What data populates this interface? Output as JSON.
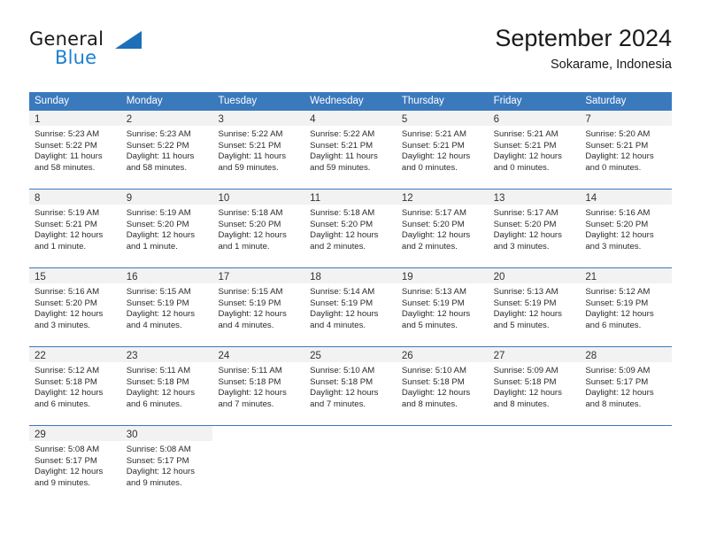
{
  "brand": {
    "name_part1": "General",
    "name_part2": "Blue",
    "triangle_color": "#1d6fb8",
    "blue_color": "#1c7fd1"
  },
  "header": {
    "title": "September 2024",
    "subtitle": "Sokarame, Indonesia"
  },
  "theme": {
    "header_bg": "#3b79bd",
    "row_divider": "#3b79bd",
    "daynum_bg": "#f2f2f2"
  },
  "weekdays": [
    "Sunday",
    "Monday",
    "Tuesday",
    "Wednesday",
    "Thursday",
    "Friday",
    "Saturday"
  ],
  "weeks": [
    [
      {
        "day": "1",
        "sunrise": "Sunrise: 5:23 AM",
        "sunset": "Sunset: 5:22 PM",
        "daylight1": "Daylight: 11 hours",
        "daylight2": "and 58 minutes."
      },
      {
        "day": "2",
        "sunrise": "Sunrise: 5:23 AM",
        "sunset": "Sunset: 5:22 PM",
        "daylight1": "Daylight: 11 hours",
        "daylight2": "and 58 minutes."
      },
      {
        "day": "3",
        "sunrise": "Sunrise: 5:22 AM",
        "sunset": "Sunset: 5:21 PM",
        "daylight1": "Daylight: 11 hours",
        "daylight2": "and 59 minutes."
      },
      {
        "day": "4",
        "sunrise": "Sunrise: 5:22 AM",
        "sunset": "Sunset: 5:21 PM",
        "daylight1": "Daylight: 11 hours",
        "daylight2": "and 59 minutes."
      },
      {
        "day": "5",
        "sunrise": "Sunrise: 5:21 AM",
        "sunset": "Sunset: 5:21 PM",
        "daylight1": "Daylight: 12 hours",
        "daylight2": "and 0 minutes."
      },
      {
        "day": "6",
        "sunrise": "Sunrise: 5:21 AM",
        "sunset": "Sunset: 5:21 PM",
        "daylight1": "Daylight: 12 hours",
        "daylight2": "and 0 minutes."
      },
      {
        "day": "7",
        "sunrise": "Sunrise: 5:20 AM",
        "sunset": "Sunset: 5:21 PM",
        "daylight1": "Daylight: 12 hours",
        "daylight2": "and 0 minutes."
      }
    ],
    [
      {
        "day": "8",
        "sunrise": "Sunrise: 5:19 AM",
        "sunset": "Sunset: 5:21 PM",
        "daylight1": "Daylight: 12 hours",
        "daylight2": "and 1 minute."
      },
      {
        "day": "9",
        "sunrise": "Sunrise: 5:19 AM",
        "sunset": "Sunset: 5:20 PM",
        "daylight1": "Daylight: 12 hours",
        "daylight2": "and 1 minute."
      },
      {
        "day": "10",
        "sunrise": "Sunrise: 5:18 AM",
        "sunset": "Sunset: 5:20 PM",
        "daylight1": "Daylight: 12 hours",
        "daylight2": "and 1 minute."
      },
      {
        "day": "11",
        "sunrise": "Sunrise: 5:18 AM",
        "sunset": "Sunset: 5:20 PM",
        "daylight1": "Daylight: 12 hours",
        "daylight2": "and 2 minutes."
      },
      {
        "day": "12",
        "sunrise": "Sunrise: 5:17 AM",
        "sunset": "Sunset: 5:20 PM",
        "daylight1": "Daylight: 12 hours",
        "daylight2": "and 2 minutes."
      },
      {
        "day": "13",
        "sunrise": "Sunrise: 5:17 AM",
        "sunset": "Sunset: 5:20 PM",
        "daylight1": "Daylight: 12 hours",
        "daylight2": "and 3 minutes."
      },
      {
        "day": "14",
        "sunrise": "Sunrise: 5:16 AM",
        "sunset": "Sunset: 5:20 PM",
        "daylight1": "Daylight: 12 hours",
        "daylight2": "and 3 minutes."
      }
    ],
    [
      {
        "day": "15",
        "sunrise": "Sunrise: 5:16 AM",
        "sunset": "Sunset: 5:20 PM",
        "daylight1": "Daylight: 12 hours",
        "daylight2": "and 3 minutes."
      },
      {
        "day": "16",
        "sunrise": "Sunrise: 5:15 AM",
        "sunset": "Sunset: 5:19 PM",
        "daylight1": "Daylight: 12 hours",
        "daylight2": "and 4 minutes."
      },
      {
        "day": "17",
        "sunrise": "Sunrise: 5:15 AM",
        "sunset": "Sunset: 5:19 PM",
        "daylight1": "Daylight: 12 hours",
        "daylight2": "and 4 minutes."
      },
      {
        "day": "18",
        "sunrise": "Sunrise: 5:14 AM",
        "sunset": "Sunset: 5:19 PM",
        "daylight1": "Daylight: 12 hours",
        "daylight2": "and 4 minutes."
      },
      {
        "day": "19",
        "sunrise": "Sunrise: 5:13 AM",
        "sunset": "Sunset: 5:19 PM",
        "daylight1": "Daylight: 12 hours",
        "daylight2": "and 5 minutes."
      },
      {
        "day": "20",
        "sunrise": "Sunrise: 5:13 AM",
        "sunset": "Sunset: 5:19 PM",
        "daylight1": "Daylight: 12 hours",
        "daylight2": "and 5 minutes."
      },
      {
        "day": "21",
        "sunrise": "Sunrise: 5:12 AM",
        "sunset": "Sunset: 5:19 PM",
        "daylight1": "Daylight: 12 hours",
        "daylight2": "and 6 minutes."
      }
    ],
    [
      {
        "day": "22",
        "sunrise": "Sunrise: 5:12 AM",
        "sunset": "Sunset: 5:18 PM",
        "daylight1": "Daylight: 12 hours",
        "daylight2": "and 6 minutes."
      },
      {
        "day": "23",
        "sunrise": "Sunrise: 5:11 AM",
        "sunset": "Sunset: 5:18 PM",
        "daylight1": "Daylight: 12 hours",
        "daylight2": "and 6 minutes."
      },
      {
        "day": "24",
        "sunrise": "Sunrise: 5:11 AM",
        "sunset": "Sunset: 5:18 PM",
        "daylight1": "Daylight: 12 hours",
        "daylight2": "and 7 minutes."
      },
      {
        "day": "25",
        "sunrise": "Sunrise: 5:10 AM",
        "sunset": "Sunset: 5:18 PM",
        "daylight1": "Daylight: 12 hours",
        "daylight2": "and 7 minutes."
      },
      {
        "day": "26",
        "sunrise": "Sunrise: 5:10 AM",
        "sunset": "Sunset: 5:18 PM",
        "daylight1": "Daylight: 12 hours",
        "daylight2": "and 8 minutes."
      },
      {
        "day": "27",
        "sunrise": "Sunrise: 5:09 AM",
        "sunset": "Sunset: 5:18 PM",
        "daylight1": "Daylight: 12 hours",
        "daylight2": "and 8 minutes."
      },
      {
        "day": "28",
        "sunrise": "Sunrise: 5:09 AM",
        "sunset": "Sunset: 5:17 PM",
        "daylight1": "Daylight: 12 hours",
        "daylight2": "and 8 minutes."
      }
    ],
    [
      {
        "day": "29",
        "sunrise": "Sunrise: 5:08 AM",
        "sunset": "Sunset: 5:17 PM",
        "daylight1": "Daylight: 12 hours",
        "daylight2": "and 9 minutes."
      },
      {
        "day": "30",
        "sunrise": "Sunrise: 5:08 AM",
        "sunset": "Sunset: 5:17 PM",
        "daylight1": "Daylight: 12 hours",
        "daylight2": "and 9 minutes."
      },
      {
        "day": "",
        "sunrise": "",
        "sunset": "",
        "daylight1": "",
        "daylight2": ""
      },
      {
        "day": "",
        "sunrise": "",
        "sunset": "",
        "daylight1": "",
        "daylight2": ""
      },
      {
        "day": "",
        "sunrise": "",
        "sunset": "",
        "daylight1": "",
        "daylight2": ""
      },
      {
        "day": "",
        "sunrise": "",
        "sunset": "",
        "daylight1": "",
        "daylight2": ""
      },
      {
        "day": "",
        "sunrise": "",
        "sunset": "",
        "daylight1": "",
        "daylight2": ""
      }
    ]
  ]
}
